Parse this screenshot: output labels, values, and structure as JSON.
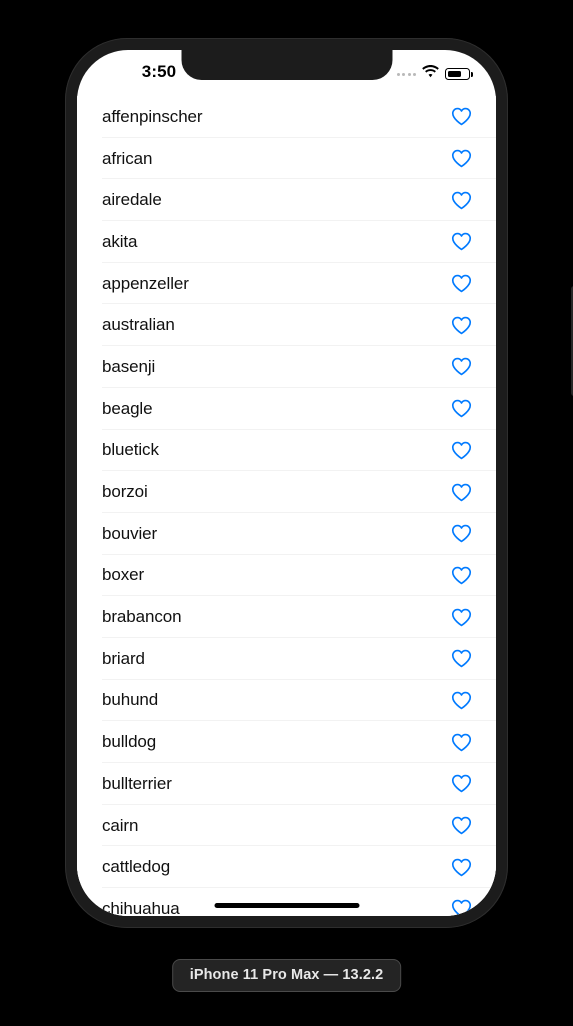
{
  "simulator": {
    "device_caption": "iPhone 11 Pro Max — 13.2.2"
  },
  "status_bar": {
    "time": "3:50",
    "signal_icon": "signal-dots-icon",
    "wifi_icon": "wifi-icon",
    "battery_icon": "battery-icon",
    "battery_level_percent": 70
  },
  "colors": {
    "accent_blue": "#007AFF",
    "row_text": "#111111",
    "divider": "#f2f2f2",
    "screen_background": "#ffffff",
    "frame": "#1c1c1c",
    "page_background": "#000000",
    "badge_background": "#242424",
    "badge_text": "#e8e8e8"
  },
  "list": {
    "favorite_icon": "heart-outline-icon",
    "rows": [
      {
        "label": "affenpinscher",
        "favorited": false
      },
      {
        "label": "african",
        "favorited": false
      },
      {
        "label": "airedale",
        "favorited": false
      },
      {
        "label": "akita",
        "favorited": false
      },
      {
        "label": "appenzeller",
        "favorited": false
      },
      {
        "label": "australian",
        "favorited": false
      },
      {
        "label": "basenji",
        "favorited": false
      },
      {
        "label": "beagle",
        "favorited": false
      },
      {
        "label": "bluetick",
        "favorited": false
      },
      {
        "label": "borzoi",
        "favorited": false
      },
      {
        "label": "bouvier",
        "favorited": false
      },
      {
        "label": "boxer",
        "favorited": false
      },
      {
        "label": "brabancon",
        "favorited": false
      },
      {
        "label": "briard",
        "favorited": false
      },
      {
        "label": "buhund",
        "favorited": false
      },
      {
        "label": "bulldog",
        "favorited": false
      },
      {
        "label": "bullterrier",
        "favorited": false
      },
      {
        "label": "cairn",
        "favorited": false
      },
      {
        "label": "cattledog",
        "favorited": false
      },
      {
        "label": "chihuahua",
        "favorited": false
      }
    ]
  }
}
